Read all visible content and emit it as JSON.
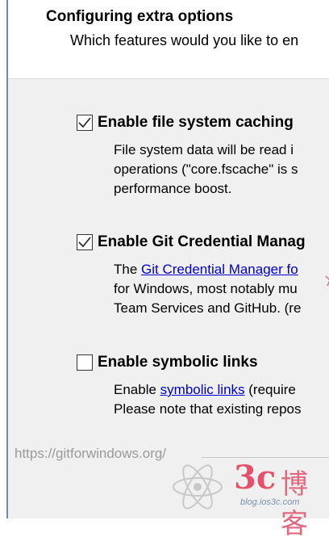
{
  "header": {
    "title": "Configuring extra options",
    "subtitle": "Which features would you like to en"
  },
  "options": [
    {
      "label": "Enable file system caching",
      "checked": true,
      "lines": [
        "File system data will be read i",
        "operations (\"core.fscache\" is s",
        "performance boost."
      ]
    },
    {
      "label": "Enable Git Credential Manag",
      "checked": true,
      "line1_prefix": "The ",
      "line1_link": "Git Credential Manager fo",
      "line2": "for Windows, most notably mu",
      "line3": "Team Services and GitHub. (re"
    },
    {
      "label": "Enable symbolic links",
      "checked": false,
      "line1_prefix": "Enable ",
      "line1_link": "symbolic links",
      "line1_suffix": " (require",
      "line2": "Please note that existing repos"
    }
  ],
  "footer": {
    "url": "https://gitforwindows.org/"
  },
  "watermark": {
    "brand": "3c",
    "chinese": "博客",
    "site": "blog.ios3c.com",
    "colors": {
      "brand": "#e6506a",
      "site": "#7a8fb0"
    }
  },
  "colors": {
    "link": "#0000cc",
    "panel": "#f0f0f0",
    "header_bg": "#ffffff",
    "footer_text": "#9a9a9a"
  }
}
